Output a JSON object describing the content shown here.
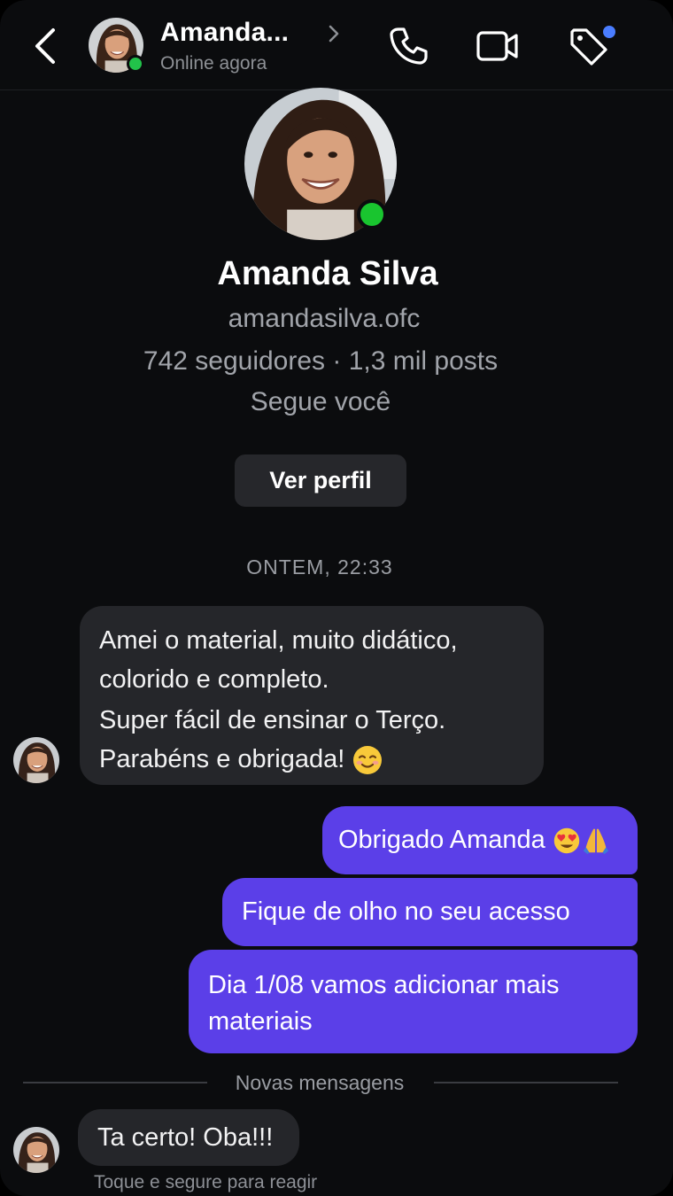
{
  "header": {
    "contact_name": "Amanda...",
    "status": "Online agora"
  },
  "profile": {
    "name": "Amanda Silva",
    "username": "amandasilva.ofc",
    "stats": "742 seguidores · 1,3 mil posts",
    "follow_status": "Segue você",
    "view_profile_label": "Ver perfil"
  },
  "conversation": {
    "timestamp": "ONTEM, 22:33",
    "incoming_1": {
      "line_1": "Amei o material, muito didático,",
      "line_2": "colorido e completo.",
      "line_3": "Super fácil de ensinar o Terço.",
      "line_4": "Parabéns e obrigada!",
      "emoji": "smiling-face-icon"
    },
    "outgoing": [
      {
        "text": "Obrigado Amanda",
        "emojis": [
          "heart-eyes-icon",
          "praying-hands-icon"
        ]
      },
      {
        "text": "Fique de olho no seu acesso"
      },
      {
        "text": "Dia 1/08 vamos adicionar mais materiais"
      }
    ],
    "new_messages_label": "Novas mensagens",
    "incoming_2": "Ta certo! Oba!!!",
    "react_hint": "Toque e segure para reagir"
  },
  "colors": {
    "background": "#0b0c0e",
    "incoming_bubble": "#25262a",
    "outgoing_bubble": "#5b3fe8",
    "online": "#22c24a",
    "notification_dot": "#4a7dff"
  }
}
